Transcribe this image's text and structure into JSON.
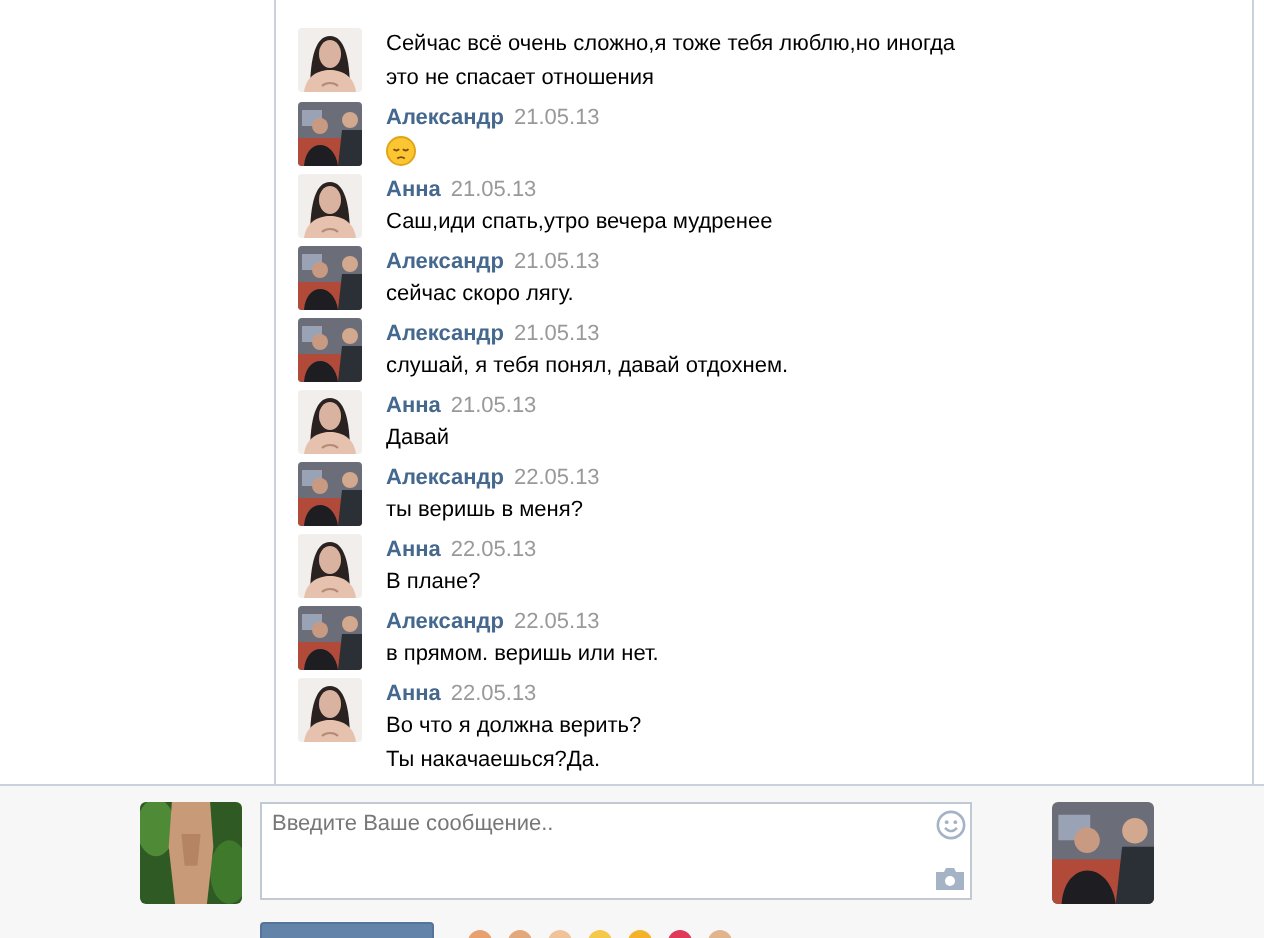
{
  "messages": [
    {
      "kind": "text",
      "lines": [
        "Сейчас всё очень сложно,я тоже тебя люблю,но иногда",
        "это не спасает отношения"
      ]
    },
    {
      "kind": "emoji",
      "author": "Александр",
      "date": "21.05.13"
    },
    {
      "kind": "text",
      "author": "Анна",
      "date": "21.05.13",
      "lines": [
        "Саш,иди спать,утро вечера мудренее"
      ]
    },
    {
      "kind": "text",
      "author": "Александр",
      "date": "21.05.13",
      "lines": [
        "сейчас скоро лягу."
      ]
    },
    {
      "kind": "text",
      "author": "Александр",
      "date": "21.05.13",
      "lines": [
        "слушай, я тебя понял, давай отдохнем."
      ]
    },
    {
      "kind": "text",
      "author": "Анна",
      "date": "21.05.13",
      "lines": [
        "Давай"
      ]
    },
    {
      "kind": "text",
      "author": "Александр",
      "date": "22.05.13",
      "lines": [
        "ты веришь в меня?"
      ]
    },
    {
      "kind": "text",
      "author": "Анна",
      "date": "22.05.13",
      "lines": [
        "В плане?"
      ]
    },
    {
      "kind": "text",
      "author": "Александр",
      "date": "22.05.13",
      "lines": [
        "в прямом. веришь или нет."
      ]
    },
    {
      "kind": "text",
      "author": "Анна",
      "date": "22.05.13",
      "lines": [
        "Во что я должна верить?",
        "Ты накачаешься?Да."
      ]
    }
  ],
  "composer": {
    "placeholder": "Введите Ваше сообщение.."
  }
}
